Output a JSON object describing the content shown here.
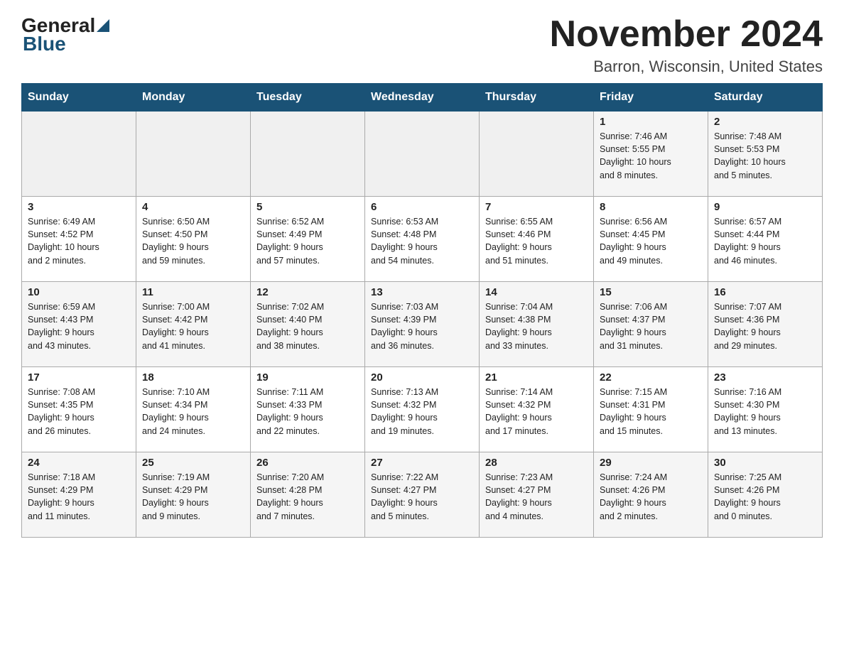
{
  "header": {
    "logo_general": "General",
    "logo_blue": "Blue",
    "title": "November 2024",
    "location": "Barron, Wisconsin, United States"
  },
  "days_of_week": [
    "Sunday",
    "Monday",
    "Tuesday",
    "Wednesday",
    "Thursday",
    "Friday",
    "Saturday"
  ],
  "weeks": [
    [
      {
        "day": "",
        "info": ""
      },
      {
        "day": "",
        "info": ""
      },
      {
        "day": "",
        "info": ""
      },
      {
        "day": "",
        "info": ""
      },
      {
        "day": "",
        "info": ""
      },
      {
        "day": "1",
        "info": "Sunrise: 7:46 AM\nSunset: 5:55 PM\nDaylight: 10 hours\nand 8 minutes."
      },
      {
        "day": "2",
        "info": "Sunrise: 7:48 AM\nSunset: 5:53 PM\nDaylight: 10 hours\nand 5 minutes."
      }
    ],
    [
      {
        "day": "3",
        "info": "Sunrise: 6:49 AM\nSunset: 4:52 PM\nDaylight: 10 hours\nand 2 minutes."
      },
      {
        "day": "4",
        "info": "Sunrise: 6:50 AM\nSunset: 4:50 PM\nDaylight: 9 hours\nand 59 minutes."
      },
      {
        "day": "5",
        "info": "Sunrise: 6:52 AM\nSunset: 4:49 PM\nDaylight: 9 hours\nand 57 minutes."
      },
      {
        "day": "6",
        "info": "Sunrise: 6:53 AM\nSunset: 4:48 PM\nDaylight: 9 hours\nand 54 minutes."
      },
      {
        "day": "7",
        "info": "Sunrise: 6:55 AM\nSunset: 4:46 PM\nDaylight: 9 hours\nand 51 minutes."
      },
      {
        "day": "8",
        "info": "Sunrise: 6:56 AM\nSunset: 4:45 PM\nDaylight: 9 hours\nand 49 minutes."
      },
      {
        "day": "9",
        "info": "Sunrise: 6:57 AM\nSunset: 4:44 PM\nDaylight: 9 hours\nand 46 minutes."
      }
    ],
    [
      {
        "day": "10",
        "info": "Sunrise: 6:59 AM\nSunset: 4:43 PM\nDaylight: 9 hours\nand 43 minutes."
      },
      {
        "day": "11",
        "info": "Sunrise: 7:00 AM\nSunset: 4:42 PM\nDaylight: 9 hours\nand 41 minutes."
      },
      {
        "day": "12",
        "info": "Sunrise: 7:02 AM\nSunset: 4:40 PM\nDaylight: 9 hours\nand 38 minutes."
      },
      {
        "day": "13",
        "info": "Sunrise: 7:03 AM\nSunset: 4:39 PM\nDaylight: 9 hours\nand 36 minutes."
      },
      {
        "day": "14",
        "info": "Sunrise: 7:04 AM\nSunset: 4:38 PM\nDaylight: 9 hours\nand 33 minutes."
      },
      {
        "day": "15",
        "info": "Sunrise: 7:06 AM\nSunset: 4:37 PM\nDaylight: 9 hours\nand 31 minutes."
      },
      {
        "day": "16",
        "info": "Sunrise: 7:07 AM\nSunset: 4:36 PM\nDaylight: 9 hours\nand 29 minutes."
      }
    ],
    [
      {
        "day": "17",
        "info": "Sunrise: 7:08 AM\nSunset: 4:35 PM\nDaylight: 9 hours\nand 26 minutes."
      },
      {
        "day": "18",
        "info": "Sunrise: 7:10 AM\nSunset: 4:34 PM\nDaylight: 9 hours\nand 24 minutes."
      },
      {
        "day": "19",
        "info": "Sunrise: 7:11 AM\nSunset: 4:33 PM\nDaylight: 9 hours\nand 22 minutes."
      },
      {
        "day": "20",
        "info": "Sunrise: 7:13 AM\nSunset: 4:32 PM\nDaylight: 9 hours\nand 19 minutes."
      },
      {
        "day": "21",
        "info": "Sunrise: 7:14 AM\nSunset: 4:32 PM\nDaylight: 9 hours\nand 17 minutes."
      },
      {
        "day": "22",
        "info": "Sunrise: 7:15 AM\nSunset: 4:31 PM\nDaylight: 9 hours\nand 15 minutes."
      },
      {
        "day": "23",
        "info": "Sunrise: 7:16 AM\nSunset: 4:30 PM\nDaylight: 9 hours\nand 13 minutes."
      }
    ],
    [
      {
        "day": "24",
        "info": "Sunrise: 7:18 AM\nSunset: 4:29 PM\nDaylight: 9 hours\nand 11 minutes."
      },
      {
        "day": "25",
        "info": "Sunrise: 7:19 AM\nSunset: 4:29 PM\nDaylight: 9 hours\nand 9 minutes."
      },
      {
        "day": "26",
        "info": "Sunrise: 7:20 AM\nSunset: 4:28 PM\nDaylight: 9 hours\nand 7 minutes."
      },
      {
        "day": "27",
        "info": "Sunrise: 7:22 AM\nSunset: 4:27 PM\nDaylight: 9 hours\nand 5 minutes."
      },
      {
        "day": "28",
        "info": "Sunrise: 7:23 AM\nSunset: 4:27 PM\nDaylight: 9 hours\nand 4 minutes."
      },
      {
        "day": "29",
        "info": "Sunrise: 7:24 AM\nSunset: 4:26 PM\nDaylight: 9 hours\nand 2 minutes."
      },
      {
        "day": "30",
        "info": "Sunrise: 7:25 AM\nSunset: 4:26 PM\nDaylight: 9 hours\nand 0 minutes."
      }
    ]
  ]
}
